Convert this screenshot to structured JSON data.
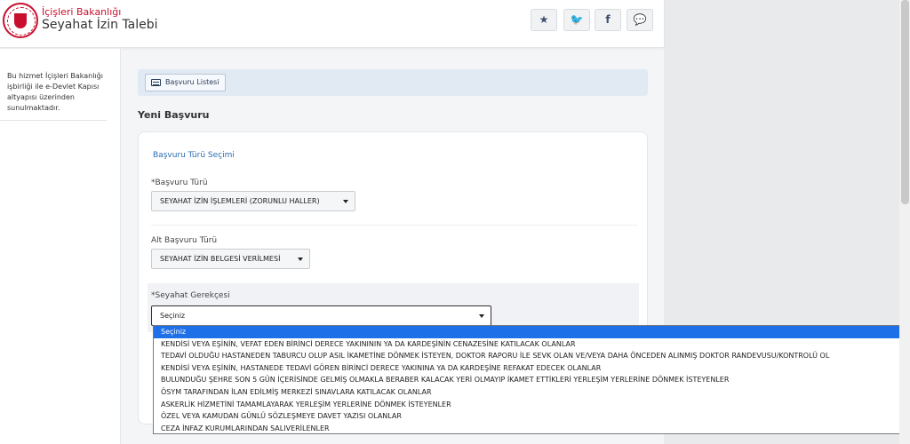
{
  "header": {
    "ministry": "İçişleri Bakanlığı",
    "title": "Seyahat İzin Talebi",
    "social": [
      {
        "icon": "star-icon",
        "glyph": "★"
      },
      {
        "icon": "twitter-icon",
        "glyph": "🐦"
      },
      {
        "icon": "facebook-icon",
        "glyph": "f"
      },
      {
        "icon": "comment-icon",
        "glyph": "💬"
      }
    ]
  },
  "sidebar": {
    "text": "Bu hizmet İçişleri Bakanlığı işbirliği ile e-Devlet Kapısı altyapısı üzerinden sunulmaktadır."
  },
  "toolbar": {
    "list_button": "Başvuru Listesi"
  },
  "main": {
    "section_title": "Yeni Başvuru",
    "card_heading": "Başvuru Türü Seçimi",
    "fields": {
      "type_label": "*Başvuru Türü",
      "type_value": "SEYAHAT İZİN İŞLEMLERİ (ZORUNLU HALLER)",
      "subtype_label": "Alt Başvuru Türü",
      "subtype_value": "SEYAHAT İZİN BELGESİ VERİLMESİ",
      "reason_label": "*Seyahat Gerekçesi",
      "reason_value": "Seçiniz"
    }
  },
  "dropdown": {
    "options": [
      "Seçiniz",
      "KENDİSİ VEYA EŞİNİN, VEFAT EDEN BİRİNCİ DERECE YAKINININ YA DA KARDEŞİNİN CENAZESİNE KATILACAK OLANLAR",
      "TEDAVİ OLDUĞU HASTANEDEN TABURCU OLUP ASIL İKAMETİNE DÖNMEK İSTEYEN, DOKTOR RAPORU İLE SEVK OLAN VE/VEYA DAHA ÖNCEDEN ALINMIŞ DOKTOR RANDEVUSU/KONTROLÜ OL",
      "KENDİSİ VEYA EŞİNİN, HASTANEDE TEDAVİ GÖREN BİRİNCİ DERECE YAKININA YA DA KARDEŞİNE REFAKAT EDECEK OLANLAR",
      "BULUNDUĞU ŞEHRE SON 5 GÜN İÇERİSİNDE GELMİŞ OLMAKLA BERABER KALACAK YERİ OLMAYIP İKAMET ETTİKLERİ YERLEŞİM YERLERİNE DÖNMEK İSTEYENLER",
      "ÖSYM TARAFINDAN İLAN EDİLMİŞ MERKEZİ SINAVLARA KATILACAK OLANLAR",
      "ASKERLİK HİZMETİNİ TAMAMLAYARAK YERLEŞİM YERLERİNE DÖNMEK İSTEYENLER",
      "ÖZEL VEYA KAMUDAN GÜNLÜ SÖZLEŞMEYE DAVET YAZISI OLANLAR",
      "CEZA İNFAZ KURUMLARINDAN SALIVERİLENLER"
    ],
    "selected_index": 0,
    "selected_color": "#1e70e8"
  }
}
